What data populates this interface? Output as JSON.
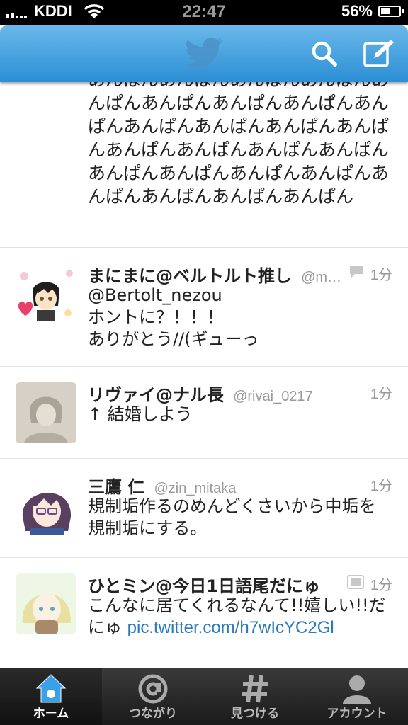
{
  "status": {
    "carrier": "KDDI",
    "time": "22:47",
    "battery": "56%",
    "battery_level": 0.56
  },
  "feed": {
    "first_text": "あんぱんあんぱんあんぱんあんぱんあんぱんあんぱんあんぱんあんぱんあんぱんあんぱんあんぱんあんぱんあんぱんあんぱんあんぱんあんぱんあんぱんあんぱんあんぱんあんぱんあんぱんあんぱんあんぱんあんぱんあんぱん",
    "tweets": [
      {
        "name": "まにまに@ベルトルト推し",
        "handle": "@m…",
        "time": "1分",
        "lines": [
          "@Bertolt_nezou",
          "ホントに？！！！",
          "ありがとう//(ギューっ"
        ]
      },
      {
        "name": "リヴァイ@ナル長",
        "handle": "@rivai_0217",
        "time": "1分",
        "lines": [
          "↑ 結婚しよう"
        ]
      },
      {
        "name": "三鷹 仁",
        "handle": "@zin_mitaka",
        "time": "1分",
        "lines": [
          "規制垢作るのめんどくさいから中垢を",
          "規制垢にする。"
        ]
      },
      {
        "name": "ひとミン@今日1日語尾だにゅ",
        "handle": "",
        "time": "1分",
        "lines": [
          "こんなに居てくれるなんて!!嬉しい!!だ"
        ],
        "line2_prefix": "にゅ ",
        "link": "pic.twitter.com/h7wIcYC2Gl"
      }
    ]
  },
  "tabs": [
    {
      "label": "ホーム",
      "icon": "home-icon"
    },
    {
      "label": "つながり",
      "icon": "at-icon"
    },
    {
      "label": "見つける",
      "icon": "hash-icon"
    },
    {
      "label": "アカウント",
      "icon": "person-icon"
    }
  ]
}
